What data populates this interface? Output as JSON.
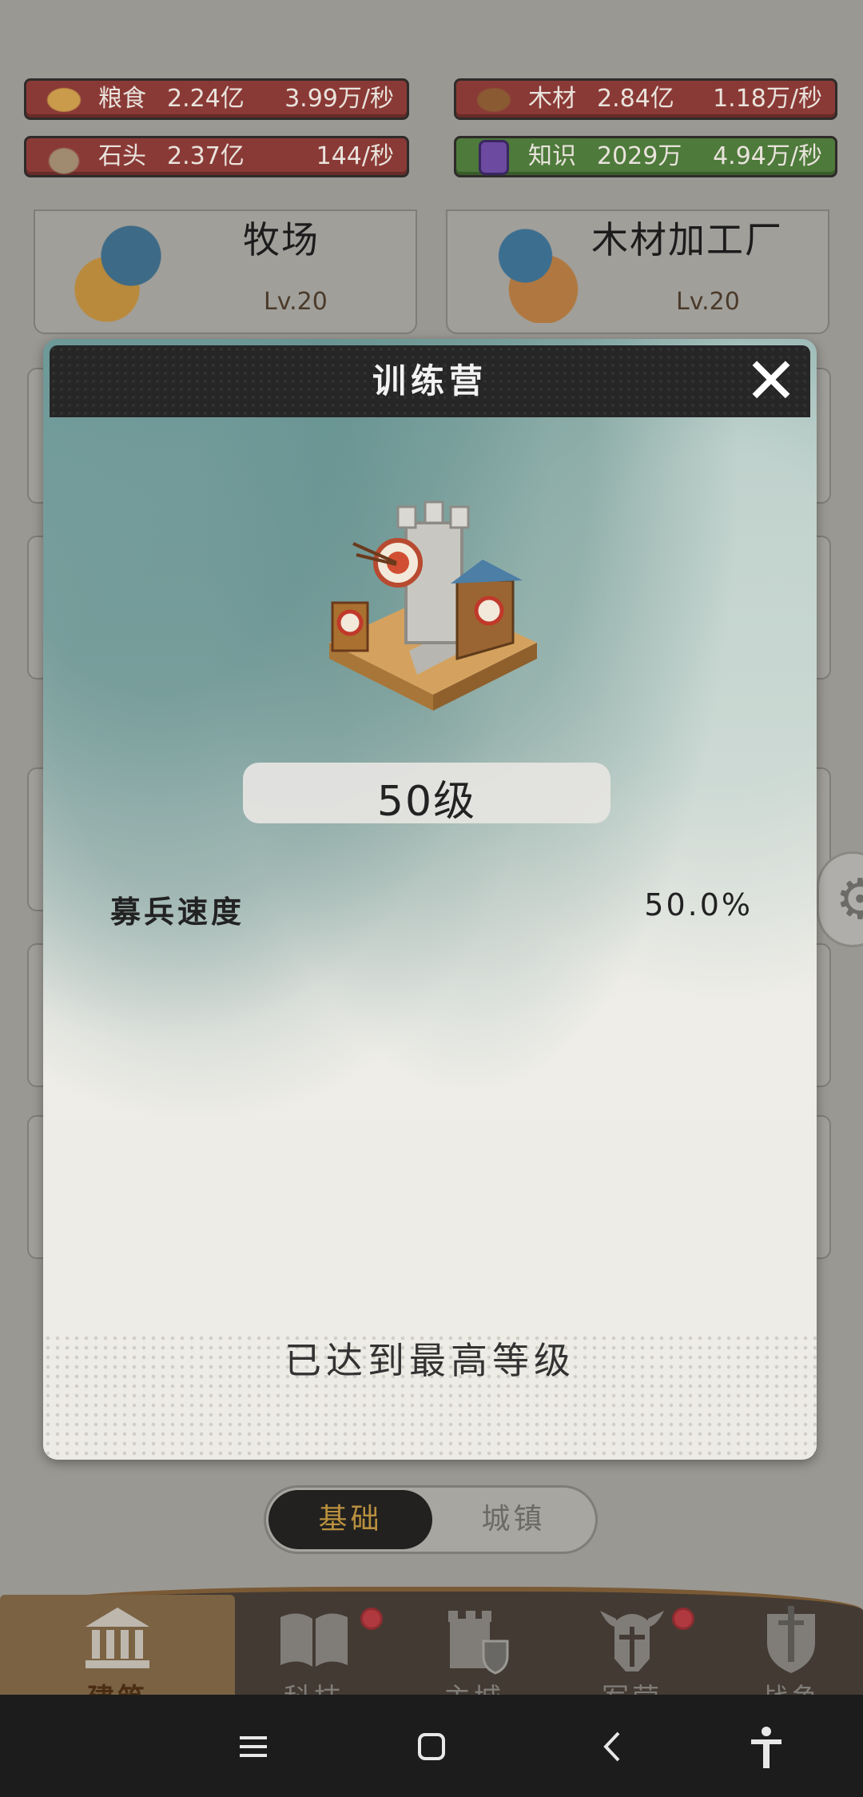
{
  "resources": [
    {
      "name": "粮食",
      "amount": "2.24亿",
      "rate": "3.99万/秒",
      "icon": "grain-icon"
    },
    {
      "name": "木材",
      "amount": "2.84亿",
      "rate": "1.18万/秒",
      "icon": "wood-icon"
    },
    {
      "name": "石头",
      "amount": "2.37亿",
      "rate": "144/秒",
      "icon": "stone-icon"
    },
    {
      "name": "知识",
      "amount": "2029万",
      "rate": "4.94万/秒",
      "icon": "book-icon"
    }
  ],
  "buildings": [
    {
      "name": "牧场",
      "level": "Lv.20"
    },
    {
      "name": "木材加工厂",
      "level": "Lv.20"
    }
  ],
  "modal": {
    "title": "训练营",
    "close_icon": "✕",
    "level": "50级",
    "stat_label": "募兵速度",
    "stat_value": "50.0%",
    "footer": "已达到最高等级"
  },
  "segment": {
    "active": "基础",
    "inactive": "城镇"
  },
  "nav": [
    {
      "label": "建筑",
      "icon": "building-icon",
      "active": true
    },
    {
      "label": "科技",
      "icon": "book-icon",
      "badge": true
    },
    {
      "label": "主城",
      "icon": "castle-icon"
    },
    {
      "label": "军营",
      "icon": "helmet-icon",
      "badge": true
    },
    {
      "label": "战争",
      "icon": "sword-shield-icon"
    }
  ],
  "colors": {
    "accent_gold": "#b9903e",
    "badge_red": "#b0393f",
    "header_dark": "#262626"
  }
}
